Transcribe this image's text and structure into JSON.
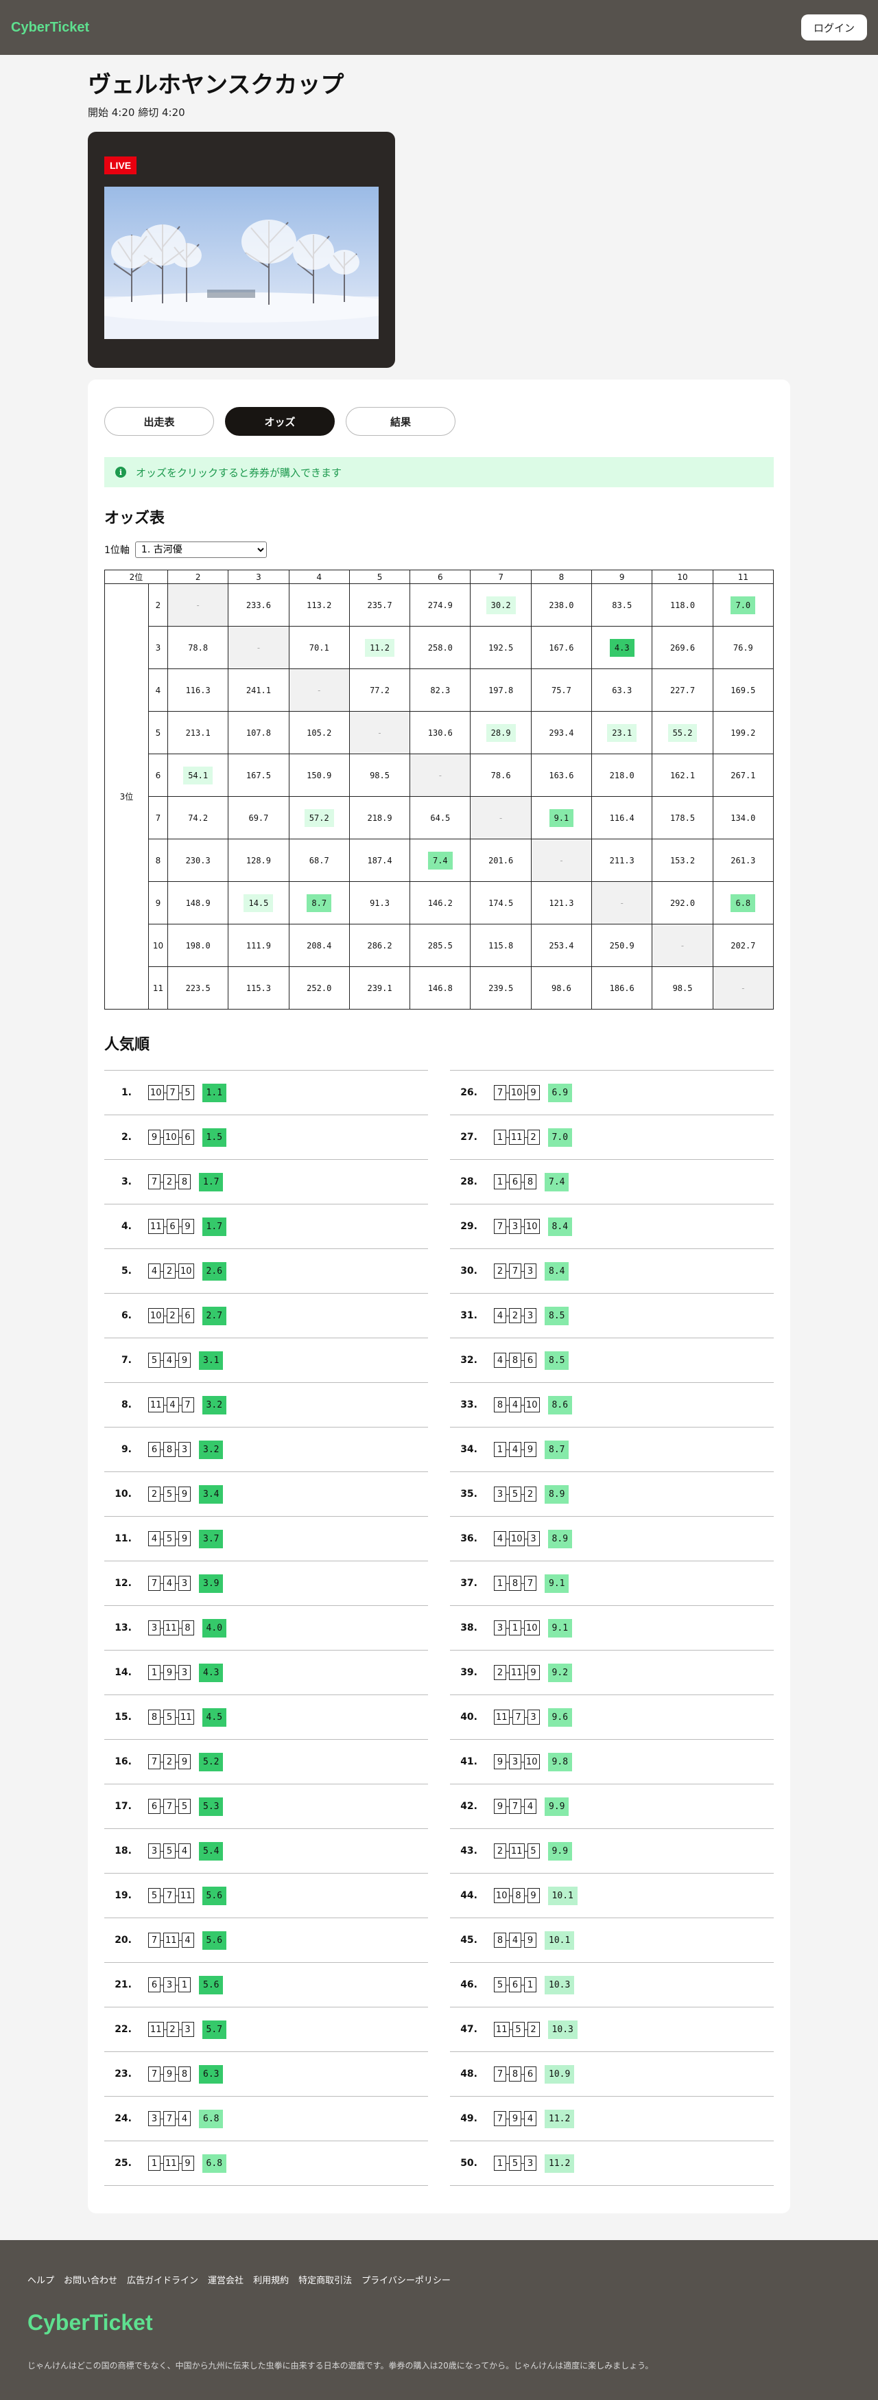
{
  "header": {
    "logo": "CyberTicket",
    "login_label": "ログイン"
  },
  "race": {
    "title": "ヴェルホヤンスクカップ",
    "time": "開始 4:20 締切 4:20",
    "live_label": "LIVE"
  },
  "tabs": [
    {
      "label": "出走表"
    },
    {
      "label": "オッズ",
      "active": true
    },
    {
      "label": "結果"
    }
  ],
  "notice": {
    "icon": "i",
    "text": "オッズをクリックすると券券が購入できます"
  },
  "odds_section": {
    "title": "オッズ表",
    "axis_label": "1位軸",
    "axis_selected": "1. 古河優",
    "corner_label": "2位",
    "side_label": "3位",
    "columns": [
      "2",
      "3",
      "4",
      "5",
      "6",
      "7",
      "8",
      "9",
      "10",
      "11"
    ],
    "rows": [
      {
        "label": "2",
        "values": [
          "-",
          "233.6",
          "113.2",
          "235.7",
          "274.9",
          "30.2",
          "238.0",
          "83.5",
          "118.0",
          "7.0"
        ]
      },
      {
        "label": "3",
        "values": [
          "78.8",
          "-",
          "70.1",
          "11.2",
          "258.0",
          "192.5",
          "167.6",
          "4.3",
          "269.6",
          "76.9"
        ]
      },
      {
        "label": "4",
        "values": [
          "116.3",
          "241.1",
          "-",
          "77.2",
          "82.3",
          "197.8",
          "75.7",
          "63.3",
          "227.7",
          "169.5"
        ]
      },
      {
        "label": "5",
        "values": [
          "213.1",
          "107.8",
          "105.2",
          "-",
          "130.6",
          "28.9",
          "293.4",
          "23.1",
          "55.2",
          "199.2"
        ]
      },
      {
        "label": "6",
        "values": [
          "54.1",
          "167.5",
          "150.9",
          "98.5",
          "-",
          "78.6",
          "163.6",
          "218.0",
          "162.1",
          "267.1"
        ]
      },
      {
        "label": "7",
        "values": [
          "74.2",
          "69.7",
          "57.2",
          "218.9",
          "64.5",
          "-",
          "9.1",
          "116.4",
          "178.5",
          "134.0"
        ]
      },
      {
        "label": "8",
        "values": [
          "230.3",
          "128.9",
          "68.7",
          "187.4",
          "7.4",
          "201.6",
          "-",
          "211.3",
          "153.2",
          "261.3"
        ]
      },
      {
        "label": "9",
        "values": [
          "148.9",
          "14.5",
          "8.7",
          "91.3",
          "146.2",
          "174.5",
          "121.3",
          "-",
          "292.0",
          "6.8"
        ]
      },
      {
        "label": "10",
        "values": [
          "198.0",
          "111.9",
          "208.4",
          "286.2",
          "285.5",
          "115.8",
          "253.4",
          "250.9",
          "-",
          "202.7"
        ]
      },
      {
        "label": "11",
        "values": [
          "223.5",
          "115.3",
          "252.0",
          "239.1",
          "146.8",
          "239.5",
          "98.6",
          "186.6",
          "98.5",
          "-"
        ]
      }
    ]
  },
  "popularity": {
    "title": "人気順",
    "left": [
      {
        "rank": "1.",
        "combo": [
          "10",
          "7",
          "5"
        ],
        "odds": "1.1"
      },
      {
        "rank": "2.",
        "combo": [
          "9",
          "10",
          "6"
        ],
        "odds": "1.5"
      },
      {
        "rank": "3.",
        "combo": [
          "7",
          "2",
          "8"
        ],
        "odds": "1.7"
      },
      {
        "rank": "4.",
        "combo": [
          "11",
          "6",
          "9"
        ],
        "odds": "1.7"
      },
      {
        "rank": "5.",
        "combo": [
          "4",
          "2",
          "10"
        ],
        "odds": "2.6"
      },
      {
        "rank": "6.",
        "combo": [
          "10",
          "2",
          "6"
        ],
        "odds": "2.7"
      },
      {
        "rank": "7.",
        "combo": [
          "5",
          "4",
          "9"
        ],
        "odds": "3.1"
      },
      {
        "rank": "8.",
        "combo": [
          "11",
          "4",
          "7"
        ],
        "odds": "3.2"
      },
      {
        "rank": "9.",
        "combo": [
          "6",
          "8",
          "3"
        ],
        "odds": "3.2"
      },
      {
        "rank": "10.",
        "combo": [
          "2",
          "5",
          "9"
        ],
        "odds": "3.4"
      },
      {
        "rank": "11.",
        "combo": [
          "4",
          "5",
          "9"
        ],
        "odds": "3.7"
      },
      {
        "rank": "12.",
        "combo": [
          "7",
          "4",
          "3"
        ],
        "odds": "3.9"
      },
      {
        "rank": "13.",
        "combo": [
          "3",
          "11",
          "8"
        ],
        "odds": "4.0"
      },
      {
        "rank": "14.",
        "combo": [
          "1",
          "9",
          "3"
        ],
        "odds": "4.3"
      },
      {
        "rank": "15.",
        "combo": [
          "8",
          "5",
          "11"
        ],
        "odds": "4.5"
      },
      {
        "rank": "16.",
        "combo": [
          "7",
          "2",
          "9"
        ],
        "odds": "5.2"
      },
      {
        "rank": "17.",
        "combo": [
          "6",
          "7",
          "5"
        ],
        "odds": "5.3"
      },
      {
        "rank": "18.",
        "combo": [
          "3",
          "5",
          "4"
        ],
        "odds": "5.4"
      },
      {
        "rank": "19.",
        "combo": [
          "5",
          "7",
          "11"
        ],
        "odds": "5.6"
      },
      {
        "rank": "20.",
        "combo": [
          "7",
          "11",
          "4"
        ],
        "odds": "5.6"
      },
      {
        "rank": "21.",
        "combo": [
          "6",
          "3",
          "1"
        ],
        "odds": "5.6"
      },
      {
        "rank": "22.",
        "combo": [
          "11",
          "2",
          "3"
        ],
        "odds": "5.7"
      },
      {
        "rank": "23.",
        "combo": [
          "7",
          "9",
          "8"
        ],
        "odds": "6.3"
      },
      {
        "rank": "24.",
        "combo": [
          "3",
          "7",
          "4"
        ],
        "odds": "6.8"
      },
      {
        "rank": "25.",
        "combo": [
          "1",
          "11",
          "9"
        ],
        "odds": "6.8"
      }
    ],
    "right": [
      {
        "rank": "26.",
        "combo": [
          "7",
          "10",
          "9"
        ],
        "odds": "6.9"
      },
      {
        "rank": "27.",
        "combo": [
          "1",
          "11",
          "2"
        ],
        "odds": "7.0"
      },
      {
        "rank": "28.",
        "combo": [
          "1",
          "6",
          "8"
        ],
        "odds": "7.4"
      },
      {
        "rank": "29.",
        "combo": [
          "7",
          "3",
          "10"
        ],
        "odds": "8.4"
      },
      {
        "rank": "30.",
        "combo": [
          "2",
          "7",
          "3"
        ],
        "odds": "8.4"
      },
      {
        "rank": "31.",
        "combo": [
          "4",
          "2",
          "3"
        ],
        "odds": "8.5"
      },
      {
        "rank": "32.",
        "combo": [
          "4",
          "8",
          "6"
        ],
        "odds": "8.5"
      },
      {
        "rank": "33.",
        "combo": [
          "8",
          "4",
          "10"
        ],
        "odds": "8.6"
      },
      {
        "rank": "34.",
        "combo": [
          "1",
          "4",
          "9"
        ],
        "odds": "8.7"
      },
      {
        "rank": "35.",
        "combo": [
          "3",
          "5",
          "2"
        ],
        "odds": "8.9"
      },
      {
        "rank": "36.",
        "combo": [
          "4",
          "10",
          "3"
        ],
        "odds": "8.9"
      },
      {
        "rank": "37.",
        "combo": [
          "1",
          "8",
          "7"
        ],
        "odds": "9.1"
      },
      {
        "rank": "38.",
        "combo": [
          "3",
          "1",
          "10"
        ],
        "odds": "9.1"
      },
      {
        "rank": "39.",
        "combo": [
          "2",
          "11",
          "9"
        ],
        "odds": "9.2"
      },
      {
        "rank": "40.",
        "combo": [
          "11",
          "7",
          "3"
        ],
        "odds": "9.6"
      },
      {
        "rank": "41.",
        "combo": [
          "9",
          "3",
          "10"
        ],
        "odds": "9.8"
      },
      {
        "rank": "42.",
        "combo": [
          "9",
          "7",
          "4"
        ],
        "odds": "9.9"
      },
      {
        "rank": "43.",
        "combo": [
          "2",
          "11",
          "5"
        ],
        "odds": "9.9"
      },
      {
        "rank": "44.",
        "combo": [
          "10",
          "8",
          "9"
        ],
        "odds": "10.1"
      },
      {
        "rank": "45.",
        "combo": [
          "8",
          "4",
          "9"
        ],
        "odds": "10.1"
      },
      {
        "rank": "46.",
        "combo": [
          "5",
          "6",
          "1"
        ],
        "odds": "10.3"
      },
      {
        "rank": "47.",
        "combo": [
          "11",
          "5",
          "2"
        ],
        "odds": "10.3"
      },
      {
        "rank": "48.",
        "combo": [
          "7",
          "8",
          "6"
        ],
        "odds": "10.9"
      },
      {
        "rank": "49.",
        "combo": [
          "7",
          "9",
          "4"
        ],
        "odds": "11.2"
      },
      {
        "rank": "50.",
        "combo": [
          "1",
          "5",
          "3"
        ],
        "odds": "11.2"
      }
    ]
  },
  "footer": {
    "links": [
      "ヘルプ",
      "お問い合わせ",
      "広告ガイドライン",
      "運営会社",
      "利用規約",
      "特定商取引法",
      "プライバシーポリシー"
    ],
    "logo": "CyberTicket",
    "description": "じゃんけんはどこの国の商標でもなく、中国から九州に伝来した虫拳に由来する日本の遊戯です。拳券の購入は20歳になってから。じゃんけんは適度に楽しみましょう。"
  },
  "colors": {
    "accent": "#5ee08f",
    "header_bg": "#56524d",
    "hot": "#35c96a",
    "warm": "#86eaa9",
    "mild": "#dcfbe6"
  }
}
